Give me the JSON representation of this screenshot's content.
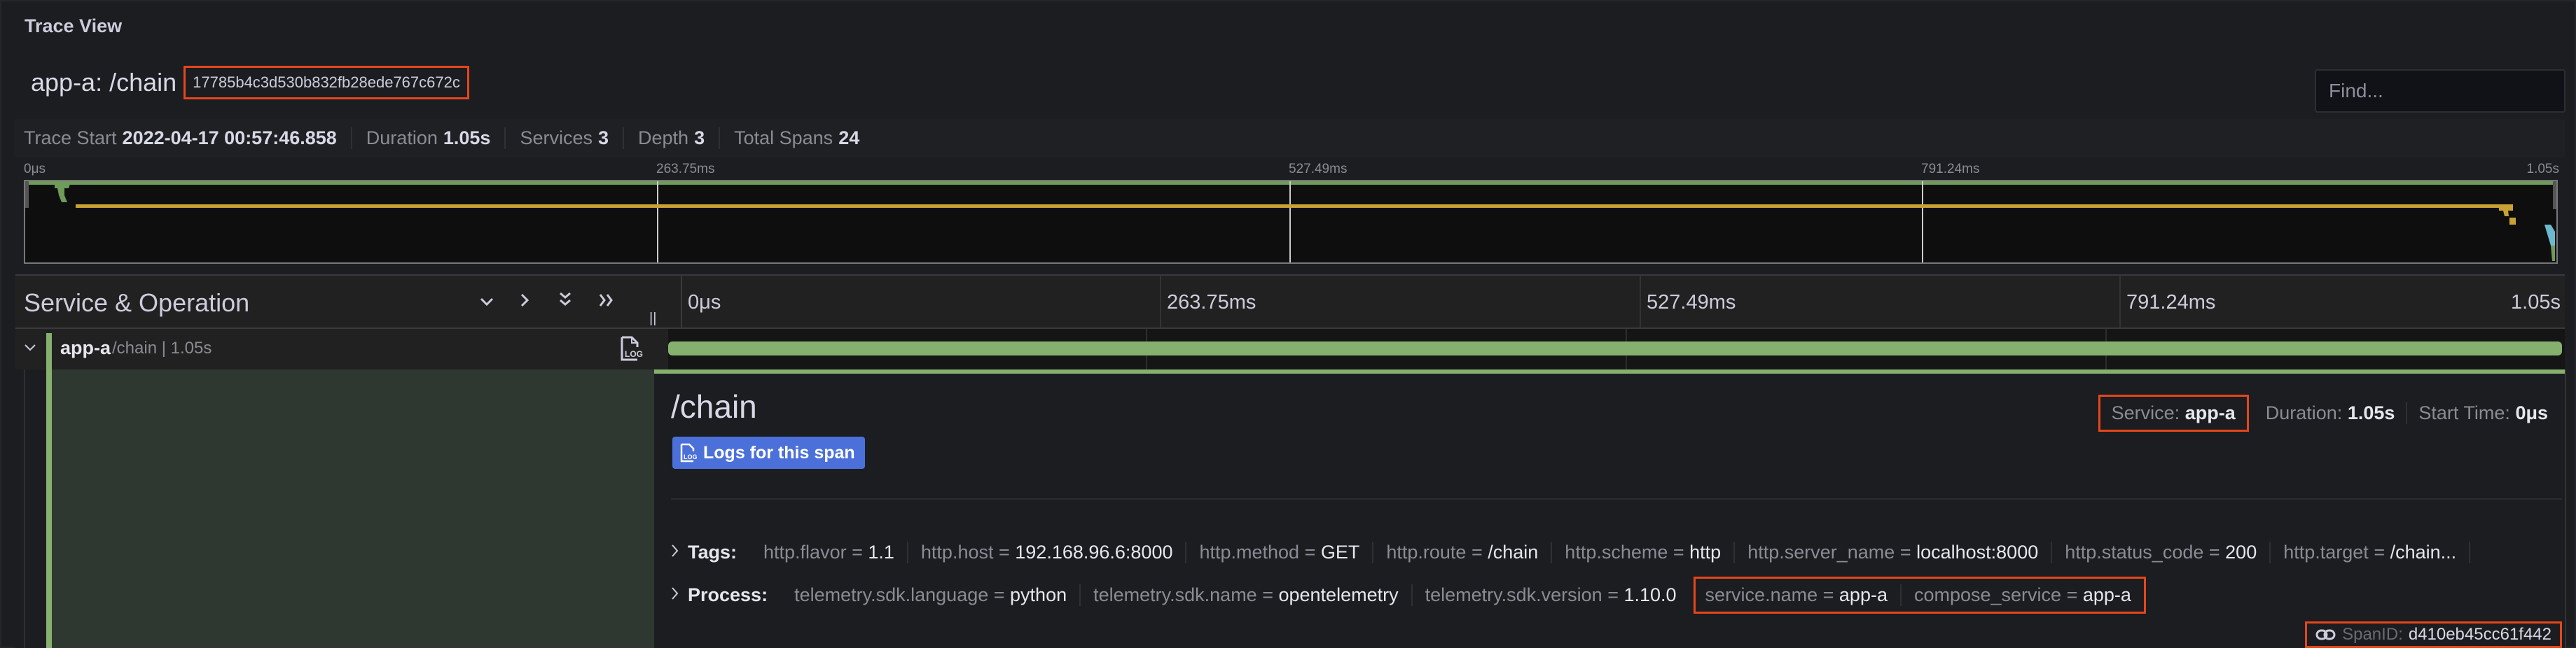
{
  "panel": {
    "title": "Trace View"
  },
  "trace": {
    "title": "app-a: /chain",
    "trace_id": "17785b4c3d530b832fb28ede767c672c"
  },
  "find": {
    "placeholder": "Find...",
    "value": ""
  },
  "meta": {
    "trace_start_label": "Trace Start",
    "trace_start_value": "2022-04-17 00:57:46.858",
    "duration_label": "Duration",
    "duration_value": "1.05s",
    "services_label": "Services",
    "services_value": "3",
    "depth_label": "Depth",
    "depth_value": "3",
    "total_spans_label": "Total Spans",
    "total_spans_value": "24"
  },
  "minimap": {
    "ticks": [
      "0μs",
      "263.75ms",
      "527.49ms",
      "791.24ms",
      "1.05s"
    ]
  },
  "timeline": {
    "header_title": "Service & Operation",
    "buttons": {
      "collapse_one": "⌄",
      "expand_one": "›",
      "collapse_all": "⌄⌄",
      "expand_all": "»"
    },
    "ticks": [
      "0μs",
      "263.75ms",
      "527.49ms",
      "791.24ms",
      "1.05s"
    ]
  },
  "span": {
    "service": "app-a",
    "operation_detail": "/chain | 1.05s",
    "bar_start_fraction": 0,
    "bar_duration_fraction": 1.0,
    "color": "#85b06d"
  },
  "detail": {
    "operation": "/chain",
    "logs_button": "Logs for this span",
    "service_label": "Service:",
    "service_value": "app-a",
    "duration_label": "Duration:",
    "duration_value": "1.05s",
    "start_label": "Start Time:",
    "start_value": "0μs",
    "tags_label": "Tags:",
    "tags": [
      {
        "key": "http.flavor",
        "value": "1.1"
      },
      {
        "key": "http.host",
        "value": "192.168.96.6:8000"
      },
      {
        "key": "http.method",
        "value": "GET"
      },
      {
        "key": "http.route",
        "value": "/chain"
      },
      {
        "key": "http.scheme",
        "value": "http"
      },
      {
        "key": "http.server_name",
        "value": "localhost:8000"
      },
      {
        "key": "http.status_code",
        "value": "200"
      },
      {
        "key": "http.target",
        "value": "/chain..."
      }
    ],
    "process_label": "Process:",
    "process": [
      {
        "key": "telemetry.sdk.language",
        "value": "python"
      },
      {
        "key": "telemetry.sdk.name",
        "value": "opentelemetry"
      },
      {
        "key": "telemetry.sdk.version",
        "value": "1.10.0"
      },
      {
        "key": "service.name",
        "value": "app-a"
      },
      {
        "key": "compose_service",
        "value": "app-a"
      }
    ],
    "span_id_label": "SpanID:",
    "span_id_value": "d410eb45cc61f442"
  },
  "colors": {
    "highlight": "#e5461b",
    "service_app_a": "#85b06d",
    "service_b": "#d4a72c",
    "service_c": "#6bb8cf",
    "button_primary": "#4b70d9"
  }
}
